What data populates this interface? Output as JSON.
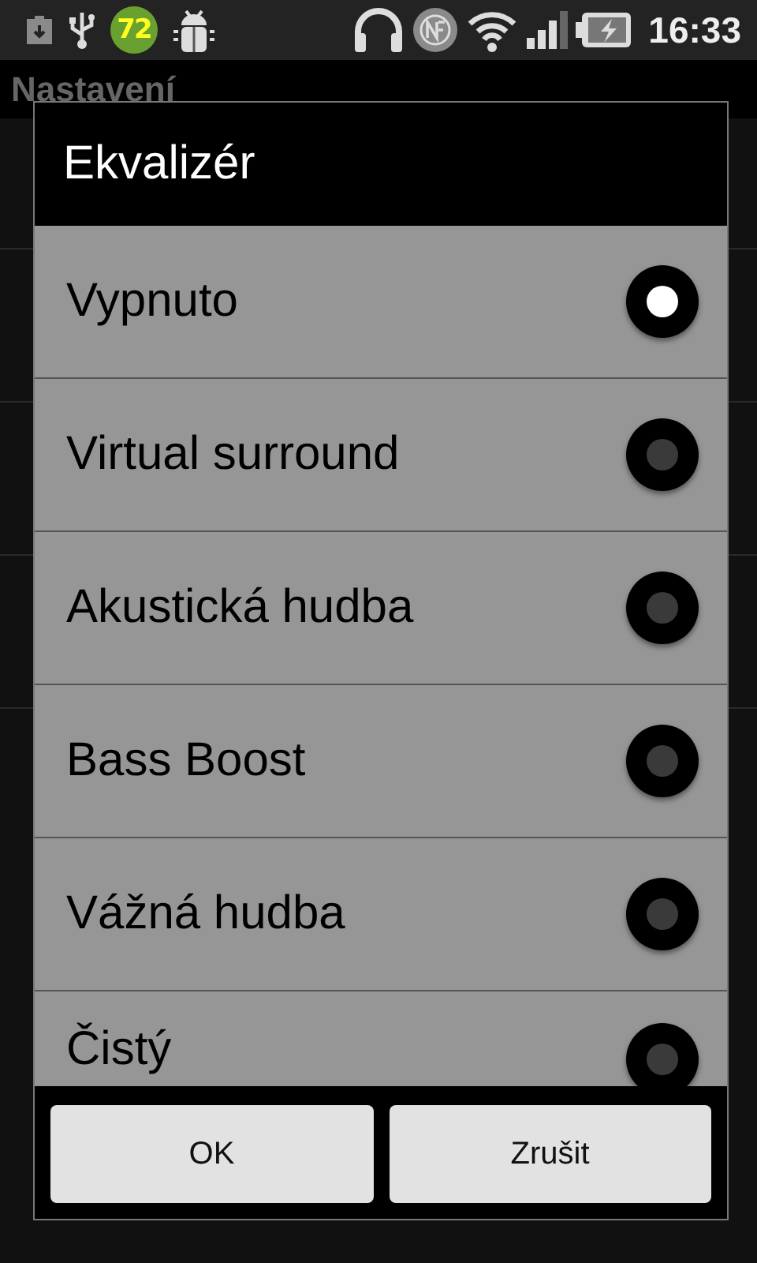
{
  "status_bar": {
    "badge": "72",
    "time": "16:33"
  },
  "app_bar": {
    "title": "Nastavení"
  },
  "dialog": {
    "title": "Ekvalizér",
    "options": [
      {
        "label": "Vypnuto",
        "selected": true
      },
      {
        "label": "Virtual surround",
        "selected": false
      },
      {
        "label": "Akustická hudba",
        "selected": false
      },
      {
        "label": "Bass Boost",
        "selected": false
      },
      {
        "label": "Vážná hudba",
        "selected": false
      },
      {
        "label": "Čistý",
        "selected": false
      }
    ],
    "buttons": [
      "OK",
      "Zrušit"
    ]
  }
}
